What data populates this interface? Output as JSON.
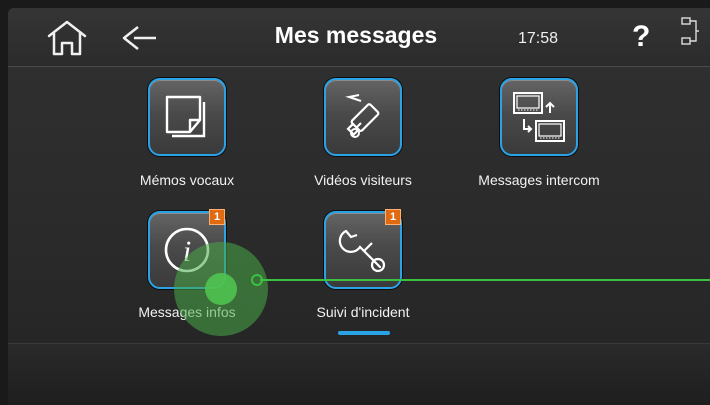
{
  "header": {
    "title": "Mes messages",
    "clock": "17:58",
    "help_label": "?",
    "icons": [
      "home-icon",
      "back-arrow-icon",
      "help-icon",
      "network-icon"
    ]
  },
  "tiles": [
    {
      "label": "Mémos vocaux",
      "icon": "note-icon",
      "badge": null
    },
    {
      "label": "Vidéos visiteurs",
      "icon": "camera-icon",
      "badge": null
    },
    {
      "label": "Messages intercom",
      "icon": "intercom-icon",
      "badge": null
    },
    {
      "label": "Messages infos",
      "icon": "info-icon",
      "badge": "1"
    },
    {
      "label": "Suivi d'incident",
      "icon": "wrench-icon",
      "badge": "1"
    }
  ],
  "colors": {
    "accent": "#2aa3e6",
    "badge": "#e06a10",
    "touch": "#3cc040"
  }
}
